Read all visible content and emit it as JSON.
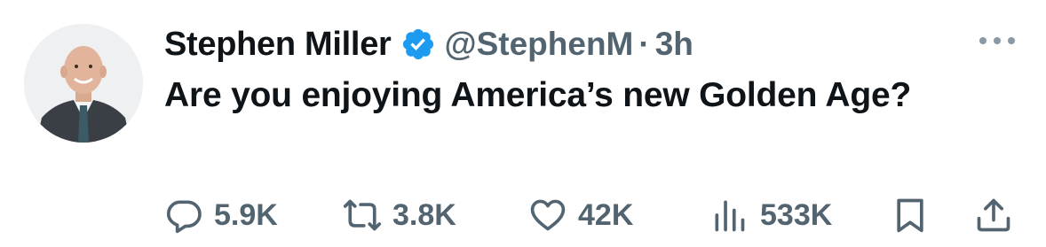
{
  "tweet": {
    "author": {
      "display_name": "Stephen Miller",
      "handle": "@StephenM",
      "verified_color": "#1d9bf0"
    },
    "separator": "·",
    "time": "3h",
    "text": "Are you enjoying America’s new Golden Age?",
    "metrics": {
      "replies": "5.9K",
      "reposts": "3.8K",
      "likes": "42K",
      "views": "533K"
    },
    "icons": {
      "reply": "reply-icon",
      "repost": "repost-icon",
      "like": "heart-icon",
      "views": "views-icon",
      "bookmark": "bookmark-icon",
      "share": "share-icon",
      "more": "more-icon",
      "verified": "verified-badge-icon"
    }
  },
  "colors": {
    "text_primary": "#0f1419",
    "text_secondary": "#536471",
    "accent": "#1d9bf0"
  }
}
